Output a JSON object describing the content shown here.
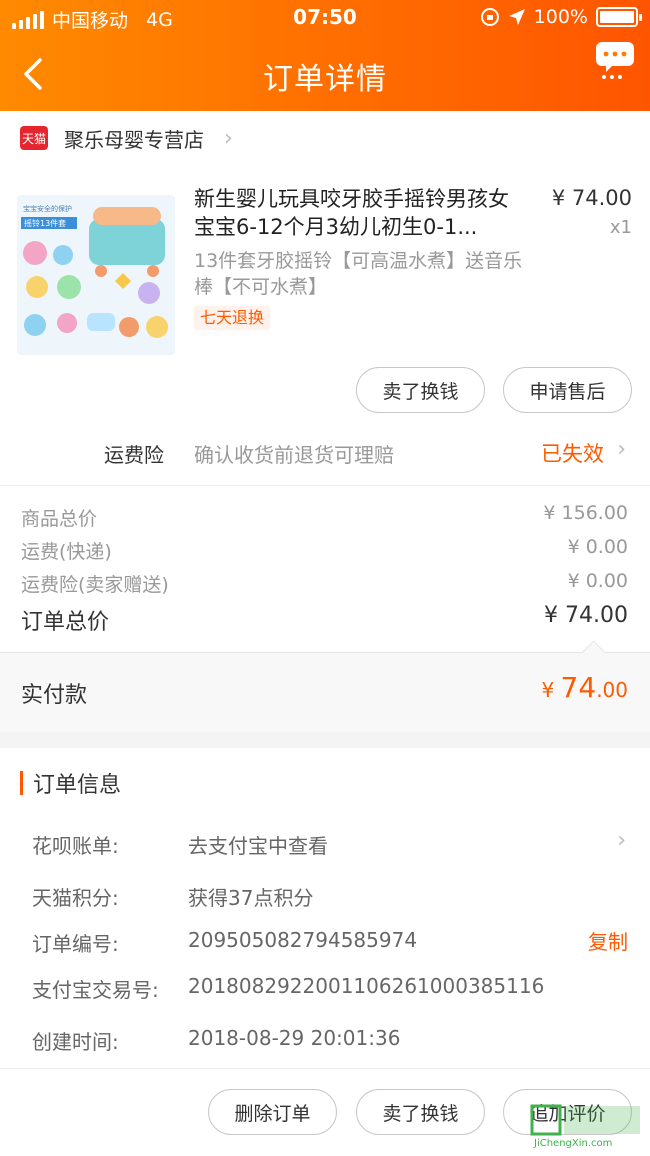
{
  "status_bar": {
    "carrier": "中国移动",
    "network": "4G",
    "time": "07:50",
    "battery": "100%"
  },
  "nav": {
    "title": "订单详情"
  },
  "store": {
    "badge": "天猫",
    "name": "聚乐母婴专营店"
  },
  "product": {
    "title": "新生婴儿玩具咬牙胶手摇铃男孩女宝宝6-12个月3幼儿初生0-1...",
    "price": "¥ 74.00",
    "qty": "x1",
    "sku": "13件套牙胶摇铃【可高温水煮】送音乐棒【不可水煮】",
    "tag": "七天退换",
    "thumb_caption_top": "宝宝安全的保护",
    "thumb_caption_main": "摇铃13件套"
  },
  "product_actions": {
    "sell": "卖了换钱",
    "after_sale": "申请售后"
  },
  "insurance": {
    "label": "运费险",
    "desc": "确认收货前退货可理赔",
    "status": "已失效"
  },
  "summary": {
    "rows": [
      {
        "label": "商品总价",
        "value": "¥ 156.00"
      },
      {
        "label": "运费(快递)",
        "value": "¥ 0.00"
      },
      {
        "label": "运费险(卖家赠送)",
        "value": "¥ 0.00"
      }
    ],
    "total_label": "订单总价",
    "total_value": "¥ 74.00",
    "paid_label": "实付款",
    "paid_symbol": "¥ ",
    "paid_int": "74",
    "paid_dec": ".00"
  },
  "order_info": {
    "title": "订单信息",
    "rows": [
      {
        "label": "花呗账单:",
        "value": "去支付宝中查看"
      },
      {
        "label": "天猫积分:",
        "value": "获得37点积分"
      },
      {
        "label": "订单编号:",
        "value": "209505082794585974"
      },
      {
        "label": "支付宝交易号:",
        "value": "2018082922001106261000385116"
      },
      {
        "label": "创建时间:",
        "value": "2018-08-29 20:01:36"
      }
    ],
    "copy": "复制"
  },
  "bottom_actions": {
    "delete": "删除订单",
    "sell": "卖了换钱",
    "review": "追加评价"
  },
  "watermark": {
    "text": "JiChengXin.com"
  },
  "colors": {
    "accent": "#ff5a00",
    "header_start": "#ff8a00",
    "header_end": "#ff5500",
    "tmall": "#e5262e"
  }
}
